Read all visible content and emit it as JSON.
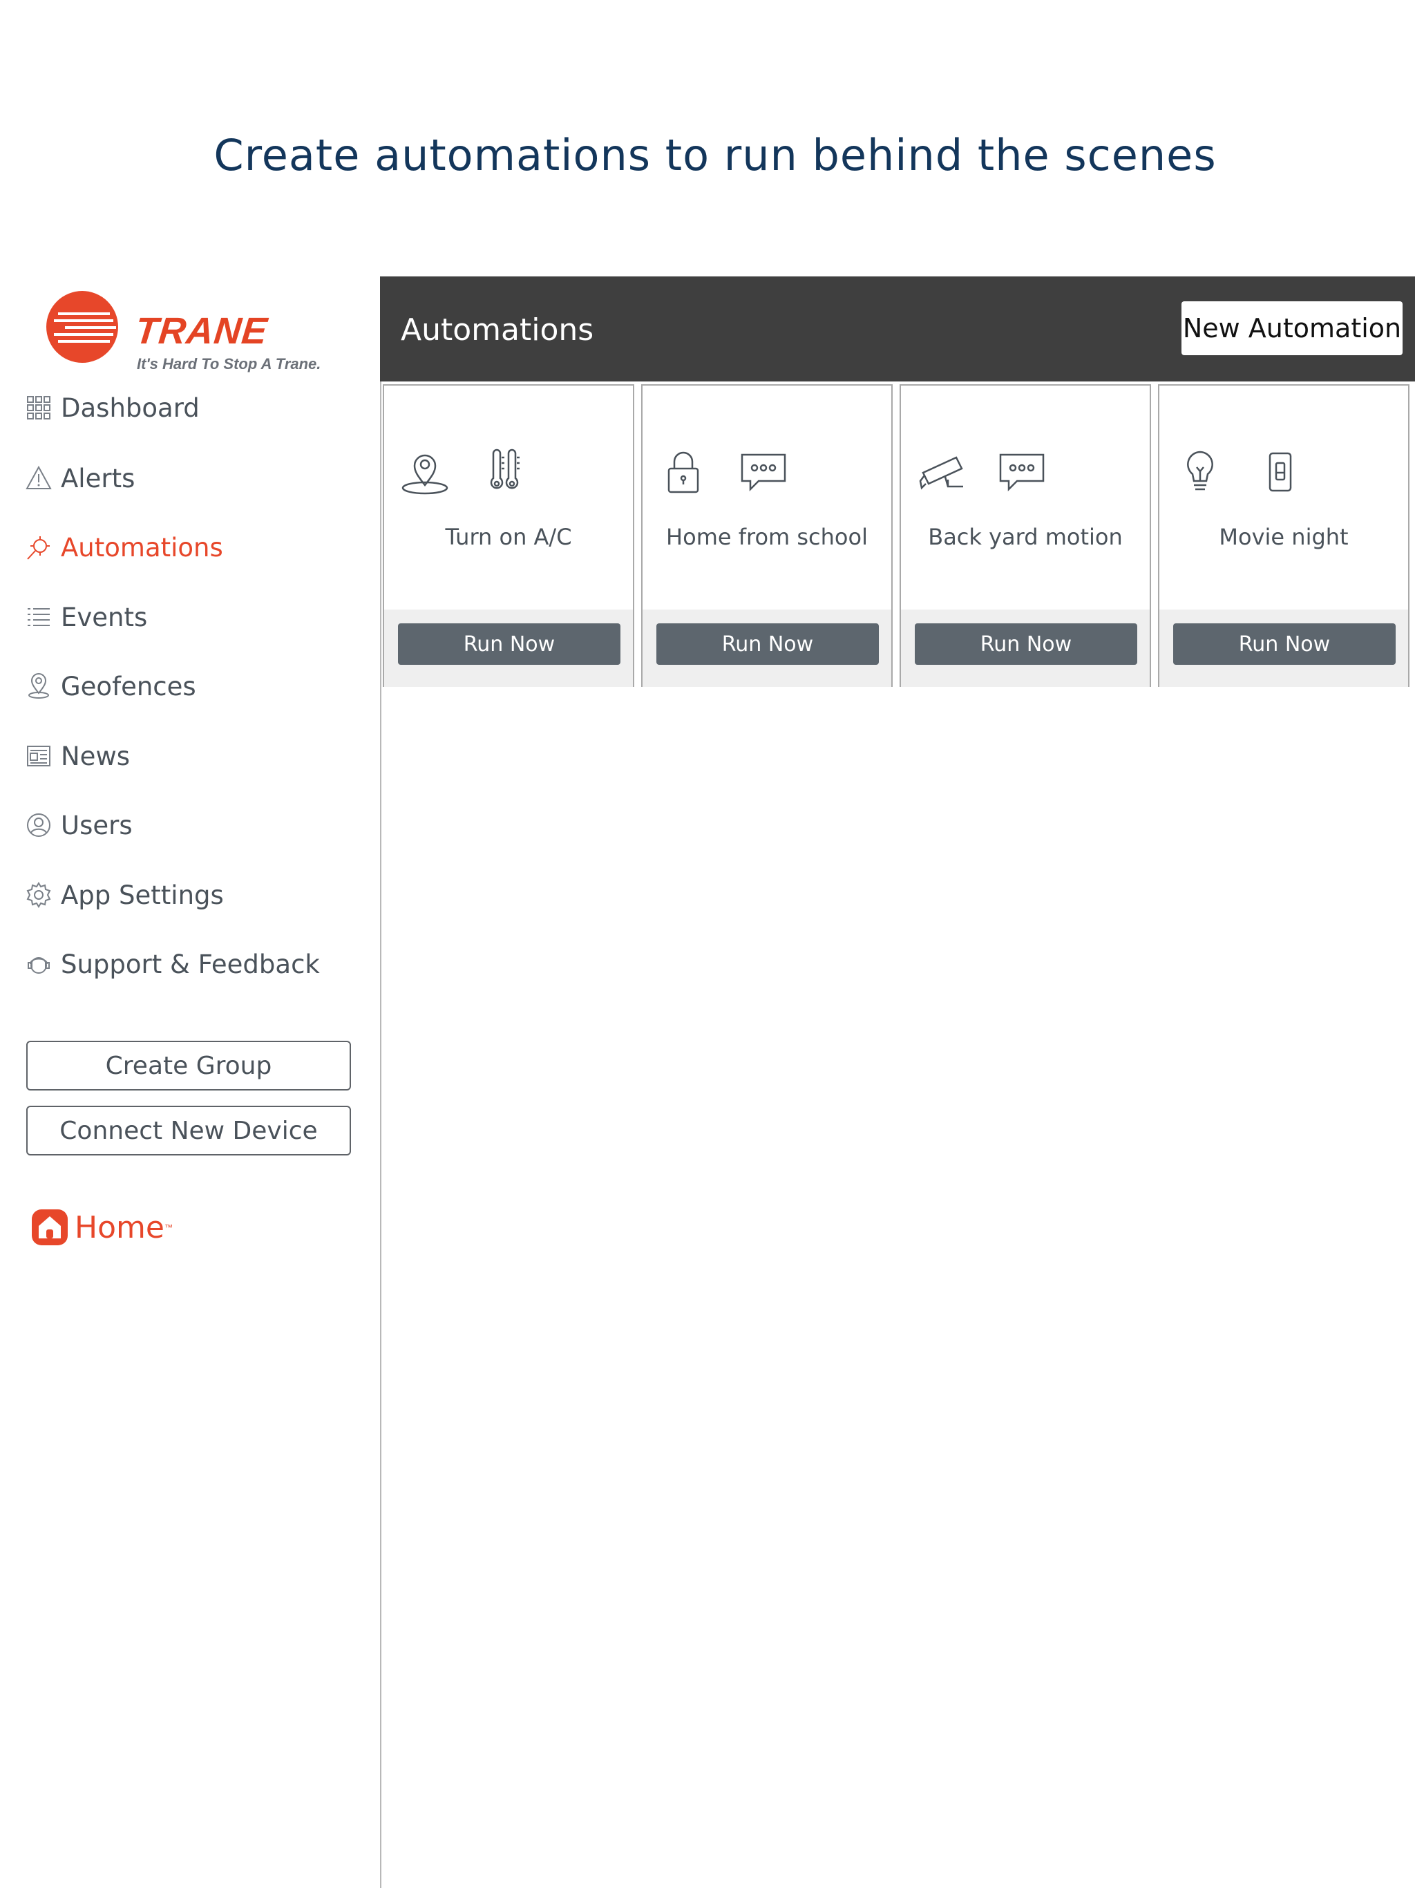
{
  "headline": "Create automations to run behind the scenes",
  "brand": {
    "name": "TRANE",
    "tagline": "It's Hard To Stop A Trane.",
    "color": "#e7472a"
  },
  "sidebar": {
    "items": [
      {
        "label": "Dashboard",
        "icon": "grid-icon",
        "active": false
      },
      {
        "label": "Alerts",
        "icon": "warning-icon",
        "active": false
      },
      {
        "label": "Automations",
        "icon": "automation-icon",
        "active": true
      },
      {
        "label": "Events",
        "icon": "list-icon",
        "active": false
      },
      {
        "label": "Geofences",
        "icon": "location-pin-icon",
        "active": false
      },
      {
        "label": "News",
        "icon": "newspaper-icon",
        "active": false
      },
      {
        "label": "Users",
        "icon": "user-icon",
        "active": false
      },
      {
        "label": "App Settings",
        "icon": "gear-icon",
        "active": false
      },
      {
        "label": "Support & Feedback",
        "icon": "support-icon",
        "active": false
      }
    ],
    "buttons": {
      "create_group": "Create Group",
      "connect_device": "Connect New Device"
    },
    "home_logo": "Home",
    "home_tm": "™"
  },
  "topbar": {
    "title": "Automations",
    "new_button": "New Automation",
    "bg_color": "#3f3f3f"
  },
  "automations": [
    {
      "title": "Turn on A/C",
      "icons": [
        "location-pin-icon",
        "thermometer-icon"
      ],
      "action": "Run Now"
    },
    {
      "title": "Home from school",
      "icons": [
        "lock-icon",
        "chat-bubble-icon"
      ],
      "action": "Run Now"
    },
    {
      "title": "Back yard motion",
      "icons": [
        "security-camera-icon",
        "chat-bubble-icon"
      ],
      "action": "Run Now"
    },
    {
      "title": "Movie night",
      "icons": [
        "lightbulb-icon",
        "light-switch-icon"
      ],
      "action": "Run Now"
    }
  ]
}
